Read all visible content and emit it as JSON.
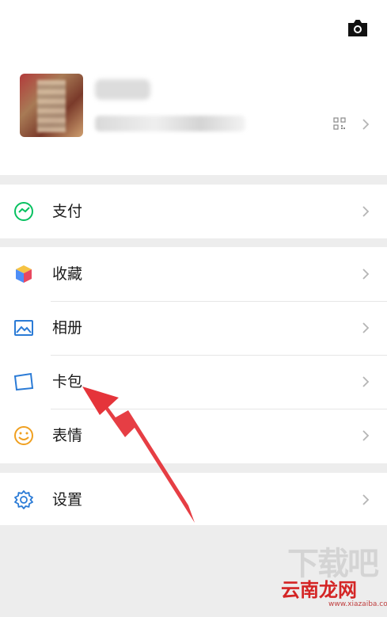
{
  "profile": {
    "camera_icon": "camera-icon",
    "name": "",
    "id_label": "",
    "id_value": "",
    "qr_icon": "qr-code-icon"
  },
  "menu": {
    "pay": {
      "label": "支付",
      "icon": "wallet-icon",
      "color": "#07c160"
    },
    "favorites": {
      "label": "收藏",
      "icon": "cube-icon"
    },
    "album": {
      "label": "相册",
      "icon": "image-icon",
      "color": "#2b7bd6"
    },
    "cards": {
      "label": "卡包",
      "icon": "card-icon",
      "color": "#2b7bd6"
    },
    "stickers": {
      "label": "表情",
      "icon": "smile-icon",
      "color": "#f0a020"
    },
    "settings": {
      "label": "设置",
      "icon": "gear-icon",
      "color": "#2b7bd6"
    }
  },
  "annotation": {
    "arrow_color": "#e5343a"
  },
  "watermark": {
    "top": "下载吧",
    "main": "云南龙网",
    "url": "www.xiazaiba.com"
  }
}
